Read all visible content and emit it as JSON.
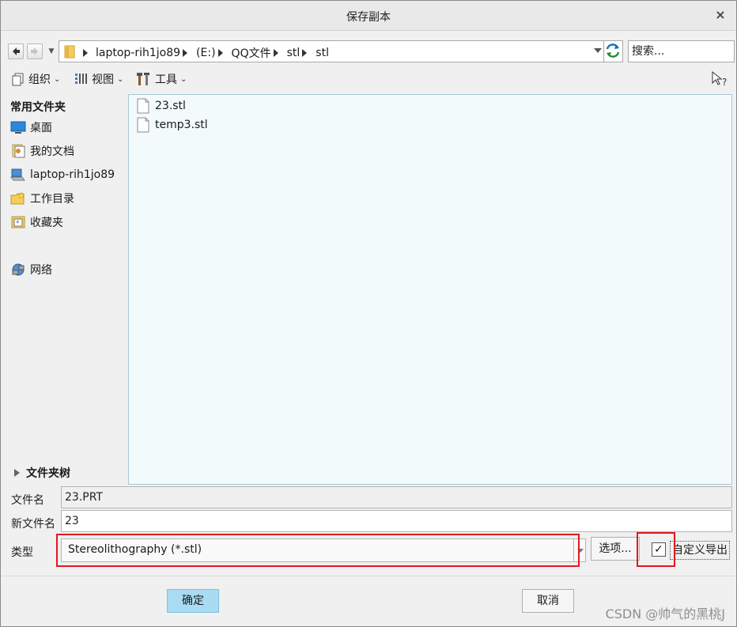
{
  "window": {
    "title": "保存副本",
    "close_label": "×"
  },
  "address": {
    "crumbs": [
      "laptop-rih1jo89",
      "(E:)",
      "QQ文件",
      "stl",
      "stl"
    ]
  },
  "search": {
    "placeholder": "搜索..."
  },
  "toolbar": {
    "organize_label": "组织",
    "view_label": "视图",
    "tools_label": "工具",
    "chevron": "⌄"
  },
  "sidebar": {
    "favorites_header": "常用文件夹",
    "items": [
      {
        "label": "桌面",
        "icon": "desktop-icon"
      },
      {
        "label": "我的文档",
        "icon": "documents-icon"
      },
      {
        "label": "laptop-rih1jo89",
        "icon": "computer-icon"
      },
      {
        "label": "工作目录",
        "icon": "working-folder-icon"
      },
      {
        "label": "收藏夹",
        "icon": "favorites-icon"
      },
      {
        "label": "网络",
        "icon": "network-icon"
      }
    ],
    "tree_header": "文件夹树"
  },
  "files": [
    {
      "name": "23.stl",
      "icon": "file-icon"
    },
    {
      "name": "temp3.stl",
      "icon": "file-icon"
    }
  ],
  "form": {
    "filename_label": "文件名",
    "filename_value": "23.PRT",
    "newname_label": "新文件名",
    "newname_value": "23",
    "type_label": "类型",
    "type_value": "Stereolithography (*.stl)",
    "options_label": "选项...",
    "custom_export_label": "自定义导出",
    "custom_export_checked": true,
    "checkmark": "✓"
  },
  "buttons": {
    "ok_label": "确定",
    "cancel_label": "取消"
  },
  "watermark": "CSDN @帅气的黑桃J",
  "colors": {
    "highlight": "#e0191f",
    "primary_button": "#a9dcf3",
    "file_pane": "#f2fafc"
  }
}
